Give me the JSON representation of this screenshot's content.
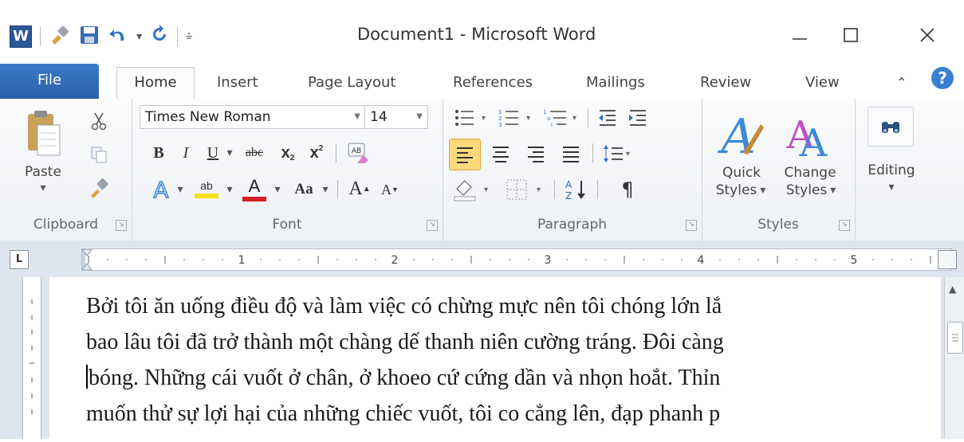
{
  "window": {
    "title": "Document1 - Microsoft Word",
    "logo_letter": "W"
  },
  "tabs": [
    "File",
    "Home",
    "Insert",
    "Page Layout",
    "References",
    "Mailings",
    "Review",
    "View"
  ],
  "clipboard": {
    "paste_label": "Paste",
    "group_label": "Clipboard"
  },
  "font": {
    "family": "Times New Roman",
    "size": "14",
    "group_label": "Font",
    "bold": "B",
    "italic": "I",
    "underline": "U",
    "strike": "abc",
    "subscript": "x",
    "superscript": "x",
    "change_case": "Aa",
    "grow": "A",
    "shrink": "A",
    "color_letter": "A",
    "highlight": "ab"
  },
  "paragraph": {
    "group_label": "Paragraph",
    "pilcrow": "¶"
  },
  "styles": {
    "quick_label_1": "Quick",
    "quick_label_2": "Styles",
    "change_label_1": "Change",
    "change_label_2": "Styles",
    "group_label": "Styles"
  },
  "editing": {
    "label": "Editing"
  },
  "ruler": {
    "numbers": [
      "1",
      "2",
      "3",
      "4",
      "5"
    ],
    "tab_selector": "L"
  },
  "document": {
    "lines": [
      "Bởi tôi ăn uống điều độ và làm việc có chừng mực nên tôi chóng lớn lắ",
      "bao lâu tôi đã trở thành một chàng dế thanh niên cường tráng. Đôi càng",
      "bóng. Những cái vuốt ở chân, ở khoeo cứ cứng dần và nhọn hoắt. Thỉn",
      "muốn thử sự lợi hại của những chiếc vuốt, tôi co cẳng lên, đạp phanh p"
    ]
  },
  "colors": {
    "file_tab": "#2a5fa8",
    "accent": "#2b5797",
    "highlight_yellow": "#f5e11b",
    "font_red": "#d42020"
  }
}
